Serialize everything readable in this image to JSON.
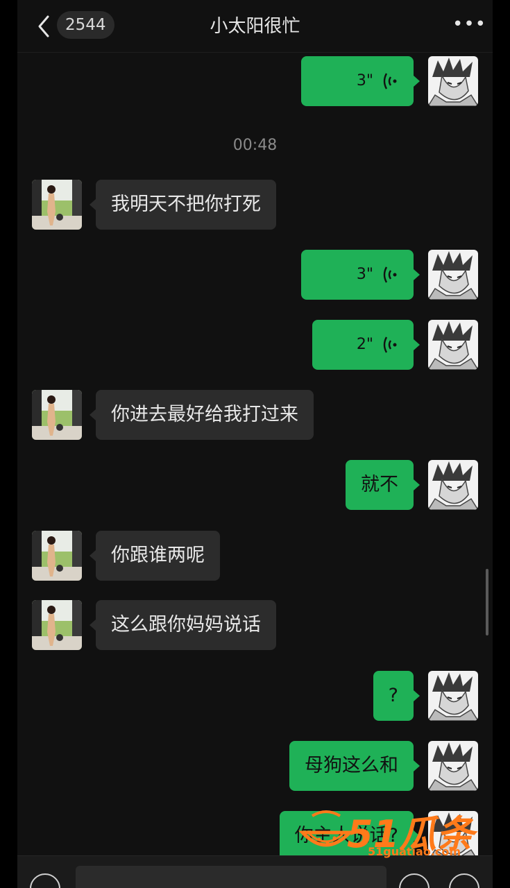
{
  "header": {
    "unread_count": "2544",
    "title": "小太阳很忙",
    "more_label": "•••"
  },
  "timestamp": "00:48",
  "messages": [
    {
      "dir": "out",
      "type": "voice",
      "duration": "3\""
    },
    {
      "dir": "in",
      "type": "text",
      "text": "我明天不把你打死"
    },
    {
      "dir": "out",
      "type": "voice",
      "duration": "3\""
    },
    {
      "dir": "out",
      "type": "voice",
      "duration": "2\""
    },
    {
      "dir": "in",
      "type": "text",
      "text": "你进去最好给我打过来"
    },
    {
      "dir": "out",
      "type": "text",
      "text": "就不"
    },
    {
      "dir": "in",
      "type": "text",
      "text": "你跟谁两呢"
    },
    {
      "dir": "in",
      "type": "text",
      "text": "这么跟你妈妈说话"
    },
    {
      "dir": "out",
      "type": "text",
      "text": "?"
    },
    {
      "dir": "out",
      "type": "text",
      "text": "母狗这么和"
    },
    {
      "dir": "out",
      "type": "text",
      "text": "你主人说话?"
    }
  ],
  "watermark": {
    "brand": "51瓜条",
    "url": "51guatiao.com"
  },
  "colors": {
    "outgoing_bubble": "#1fb157",
    "incoming_bubble": "#2c2c2c",
    "background": "#111111"
  },
  "icons": {
    "back": "chevron-left-icon",
    "more": "ellipsis-icon",
    "voice_msg": "voice-wave-icon",
    "input_voice": "voice-input-icon",
    "emoji": "emoji-icon",
    "plus": "plus-icon"
  }
}
